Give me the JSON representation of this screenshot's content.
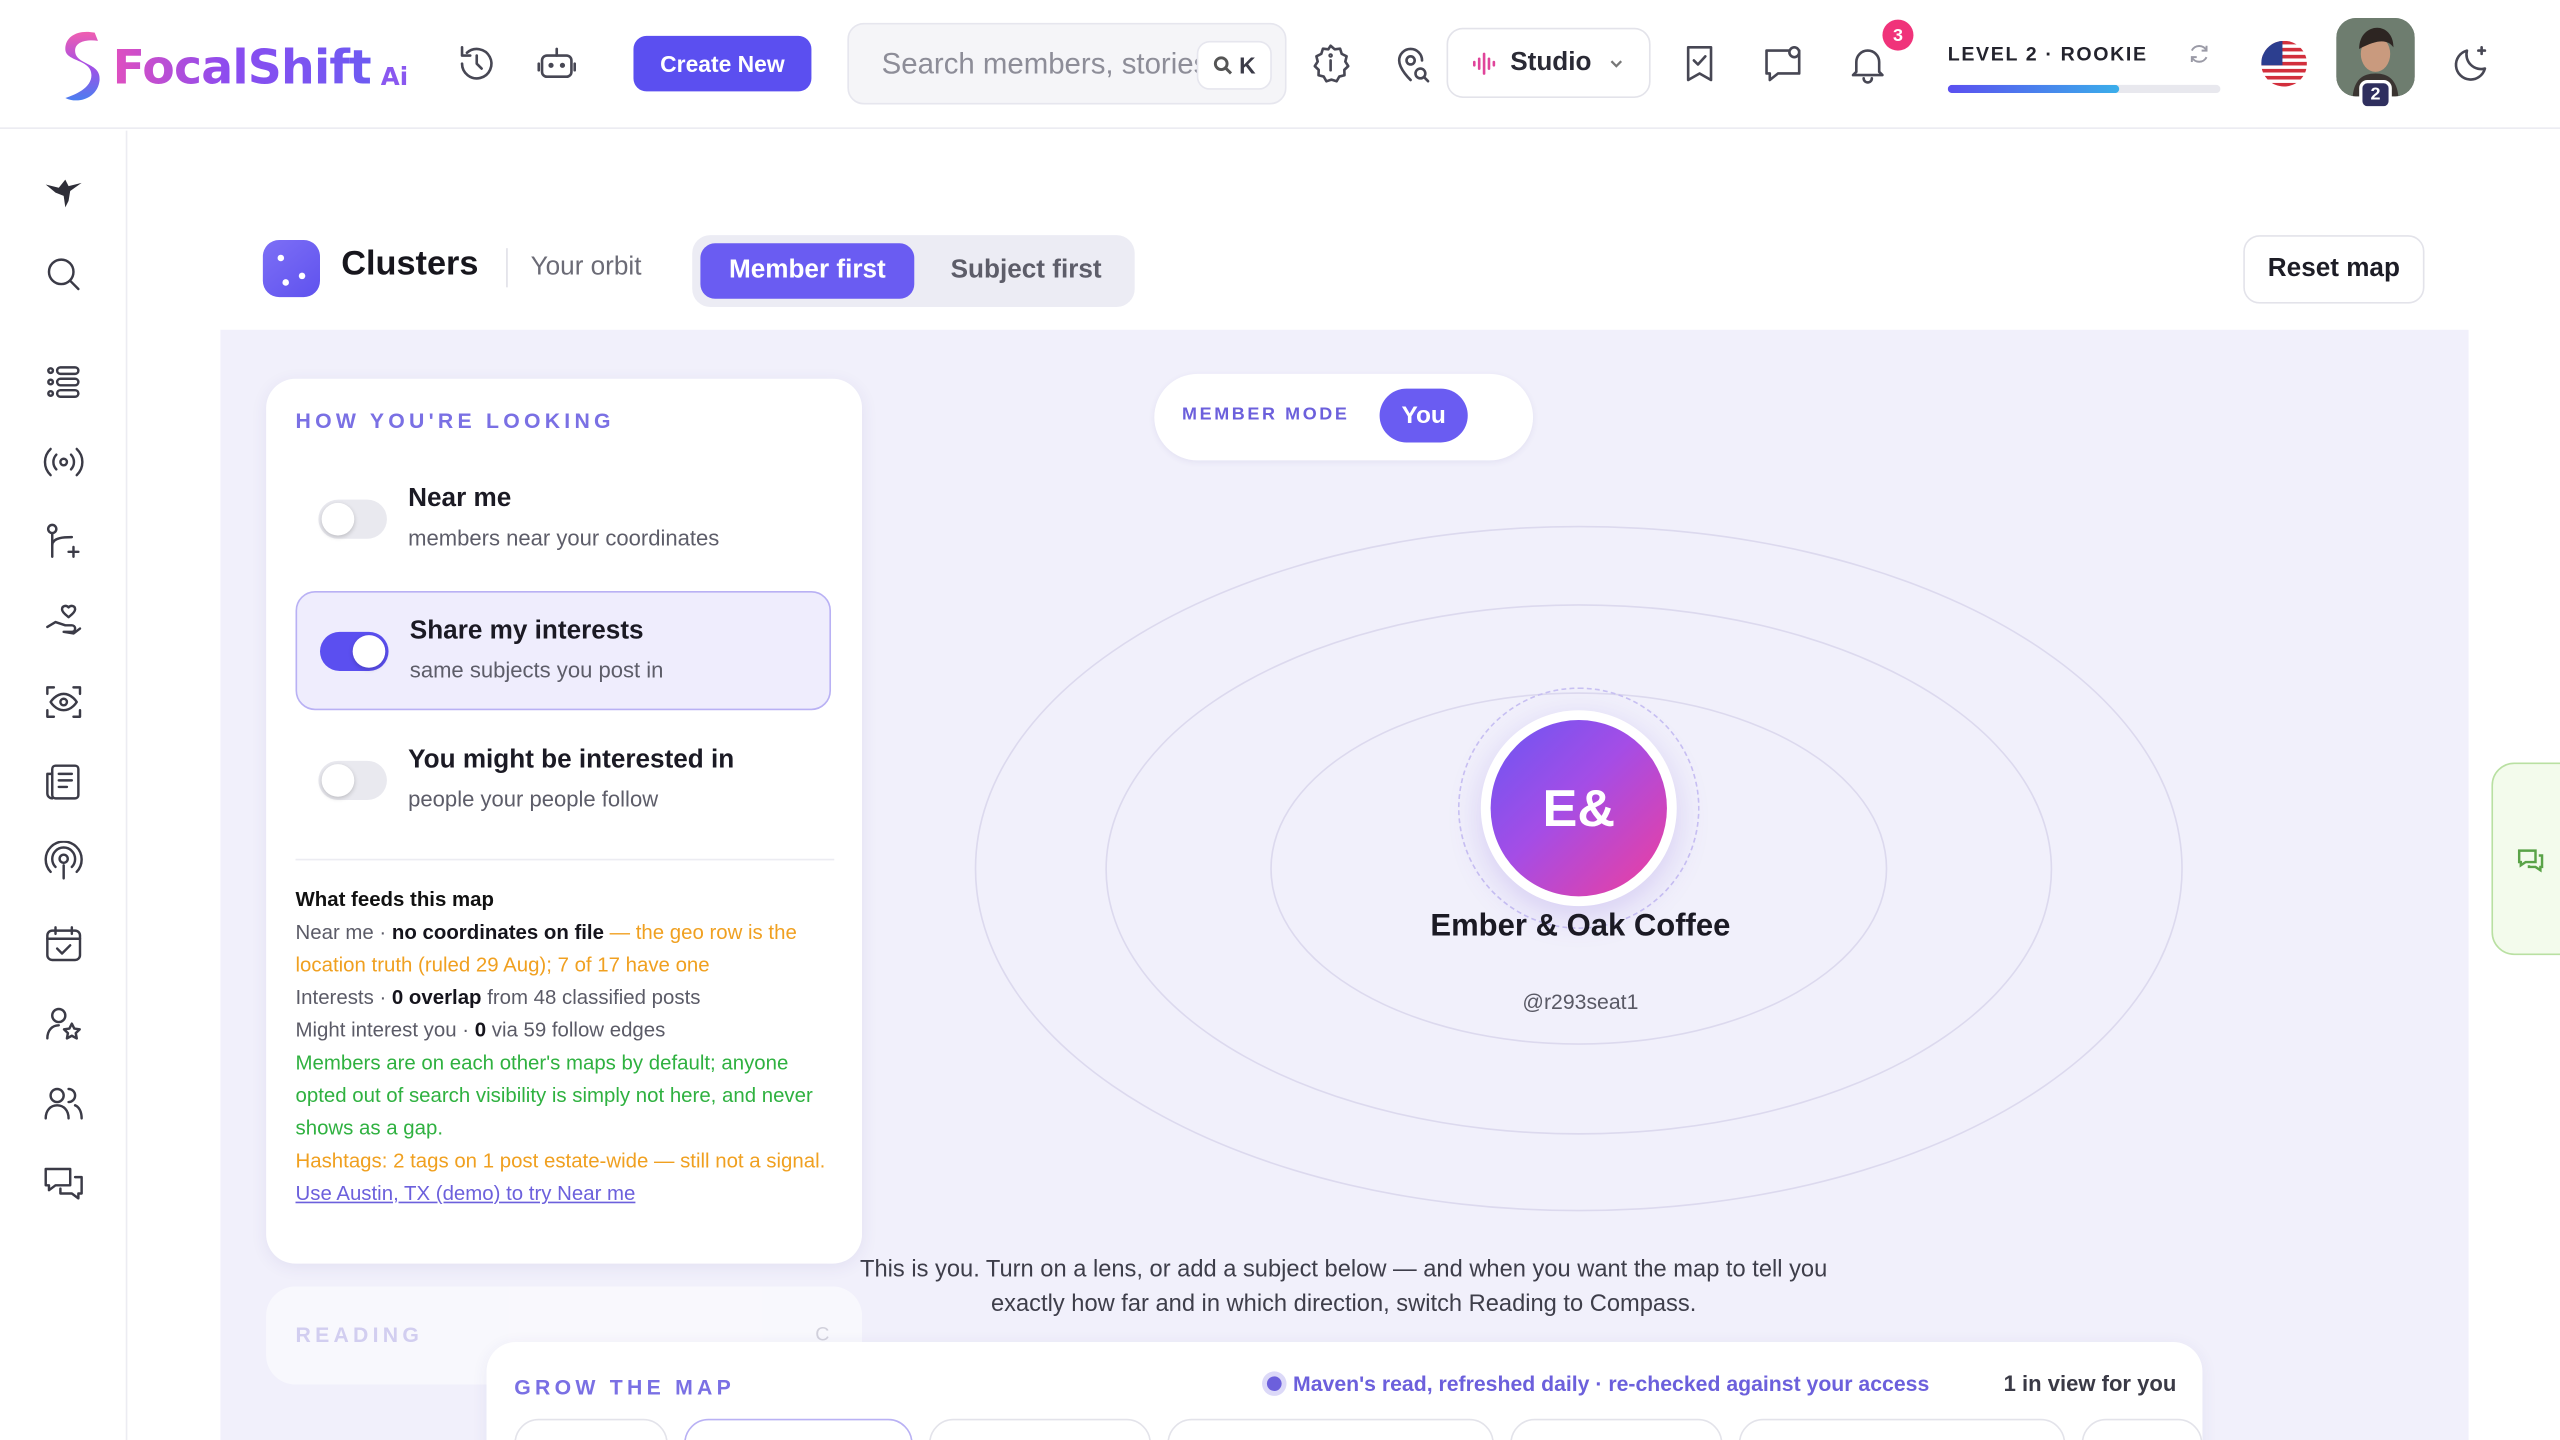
{
  "app": {
    "name": "FocalShift",
    "suffix": "Ai"
  },
  "header": {
    "create_label": "Create New",
    "search_placeholder": "Search members, stories",
    "search_shortcut": "K",
    "studio_label": "Studio",
    "notification_count": "3",
    "level_label": "LEVEL 2 · ROOKIE",
    "level_progress": 0.63,
    "avatar_level": "2"
  },
  "clusters": {
    "title": "Clusters",
    "subtitle": "Your orbit",
    "toggle_active": "Member first",
    "toggle_inactive": "Subject first",
    "reset_label": "Reset map"
  },
  "looking": {
    "heading": "HOW YOU'RE LOOKING",
    "options": [
      {
        "title": "Near me",
        "subtitle": "members near your coordinates",
        "enabled": false
      },
      {
        "title": "Share my interests",
        "subtitle": "same subjects you post in",
        "enabled": true
      },
      {
        "title": "You might be interested in",
        "subtitle": "people your people follow",
        "enabled": false
      }
    ],
    "feeds": {
      "heading": "What feeds this map",
      "near_label": "Near me · ",
      "near_bold": "no coordinates on file",
      "near_note": " — the geo row is the location truth (ruled 29 Aug); 7 of 17 have one",
      "interests_label": "Interests · ",
      "interests_bold": "0 overlap",
      "interests_note": " from 48 classified posts",
      "might_label": "Might interest you · ",
      "might_bold": "0",
      "might_note": " via 59 follow edges",
      "visibility_note": "Members are on each other's maps by default; anyone opted out of search visibility is simply not here, and never shows as a gap.",
      "hashtags_note": "Hashtags: 2 tags on 1 post estate-wide — still not a signal.",
      "demo_link": "Use Austin, TX (demo) to try Near me"
    }
  },
  "reading": {
    "heading": "READING",
    "shortcut": "C"
  },
  "map": {
    "mode_label": "MEMBER MODE",
    "mode_value": "You",
    "node_initials": "E&",
    "node_name": "Ember & Oak Coffee",
    "node_handle": "@r293seat1",
    "caption": "This is you. Turn on a lens, or add a subject below — and when you want the map to tell you exactly how far and in which direction, switch Reading to Compass."
  },
  "grow": {
    "heading": "GROW THE MAP",
    "maven_note": "Maven's read, refreshed daily · re-checked against your access",
    "in_view": "1 in view for you"
  },
  "icons": {
    "top": [
      "history-icon",
      "bot-icon",
      "info-icon",
      "location-search-icon",
      "bookmark-check-icon",
      "message-icon",
      "bell-icon",
      "refresh-icon",
      "us-flag-icon",
      "theme-icon"
    ],
    "sidebar": [
      "bird-logo-icon",
      "search-icon",
      "list-icon",
      "broadcast-icon",
      "branch-add-icon",
      "hand-heart-icon",
      "eye-scan-icon",
      "newspaper-icon",
      "podcast-icon",
      "calendar-check-icon",
      "user-star-icon",
      "users-icon",
      "chat-icon"
    ]
  },
  "colors": {
    "accent": "#5b4ff0",
    "stage_bg": "#f1f0fb",
    "badge": "#f0337a",
    "warning_text": "#f0a020",
    "success_text": "#2fb140"
  }
}
